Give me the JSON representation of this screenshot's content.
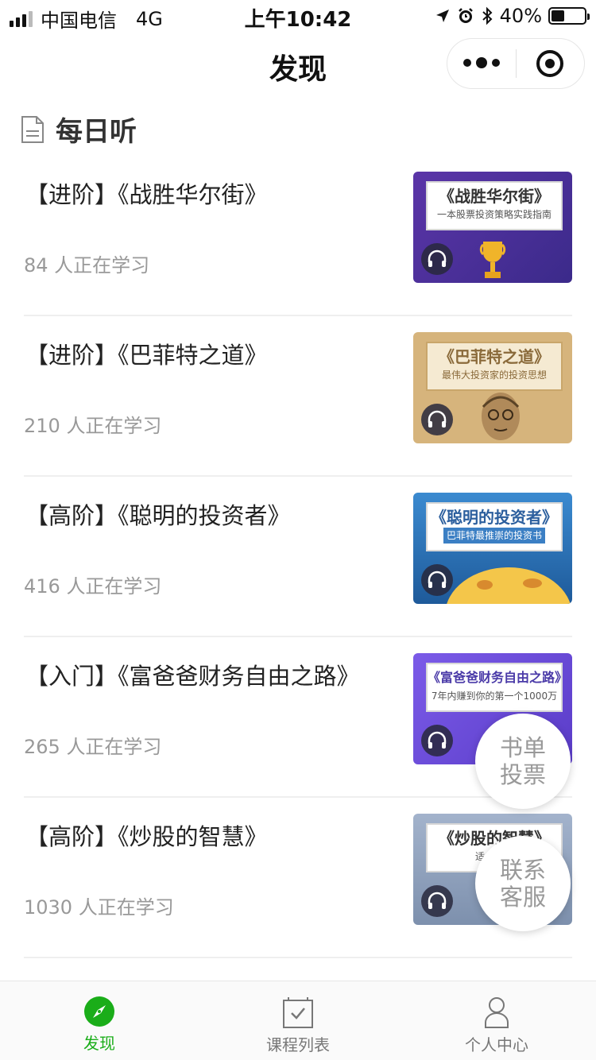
{
  "status_bar": {
    "carrier": "中国电信",
    "network": "4G",
    "time": "上午10:42",
    "battery": "40%",
    "battery_level": 0.4
  },
  "nav": {
    "title": "发现"
  },
  "section": {
    "title": "每日听"
  },
  "items": [
    {
      "title": "【进阶】《战胜华尔街》",
      "count": "84 人正在学习",
      "cover_title": "《战胜华尔街》",
      "cover_subtitle": "一本股票投资策略实践指南",
      "cover_color": "#5b35a8"
    },
    {
      "title": "【进阶】《巴菲特之道》",
      "count": "210 人正在学习",
      "cover_title": "《巴菲特之道》",
      "cover_subtitle": "最伟大投资家的投资思想",
      "cover_color": "#d6b47c"
    },
    {
      "title": "【高阶】《聪明的投资者》",
      "count": "416 人正在学习",
      "cover_title": "《聪明的投资者》",
      "cover_subtitle": "巴菲特最推崇的投资书",
      "cover_color": "#2c6fb0"
    },
    {
      "title": "【入门】《富爸爸财务自由之路》",
      "count": "265 人正在学习",
      "cover_title": "《富爸爸财务自由之路》",
      "cover_subtitle": "7年内赚到你的第一个1000万",
      "cover_color": "#6a48d8"
    },
    {
      "title": "【高阶】《炒股的智慧》",
      "count": "1030 人正在学习",
      "cover_title": "《炒股的智慧》",
      "cover_subtitle": "适合入门",
      "cover_color": "#8ea1bd"
    }
  ],
  "float_buttons": {
    "vote": [
      "书单",
      "投票"
    ],
    "service": [
      "联系",
      "客服"
    ]
  },
  "tabs": [
    {
      "label": "发现",
      "icon": "compass-icon",
      "active": true
    },
    {
      "label": "课程列表",
      "icon": "checklist-icon",
      "active": false
    },
    {
      "label": "个人中心",
      "icon": "person-icon",
      "active": false
    }
  ],
  "colors": {
    "accent": "#1aad19",
    "muted_text": "#999999"
  }
}
